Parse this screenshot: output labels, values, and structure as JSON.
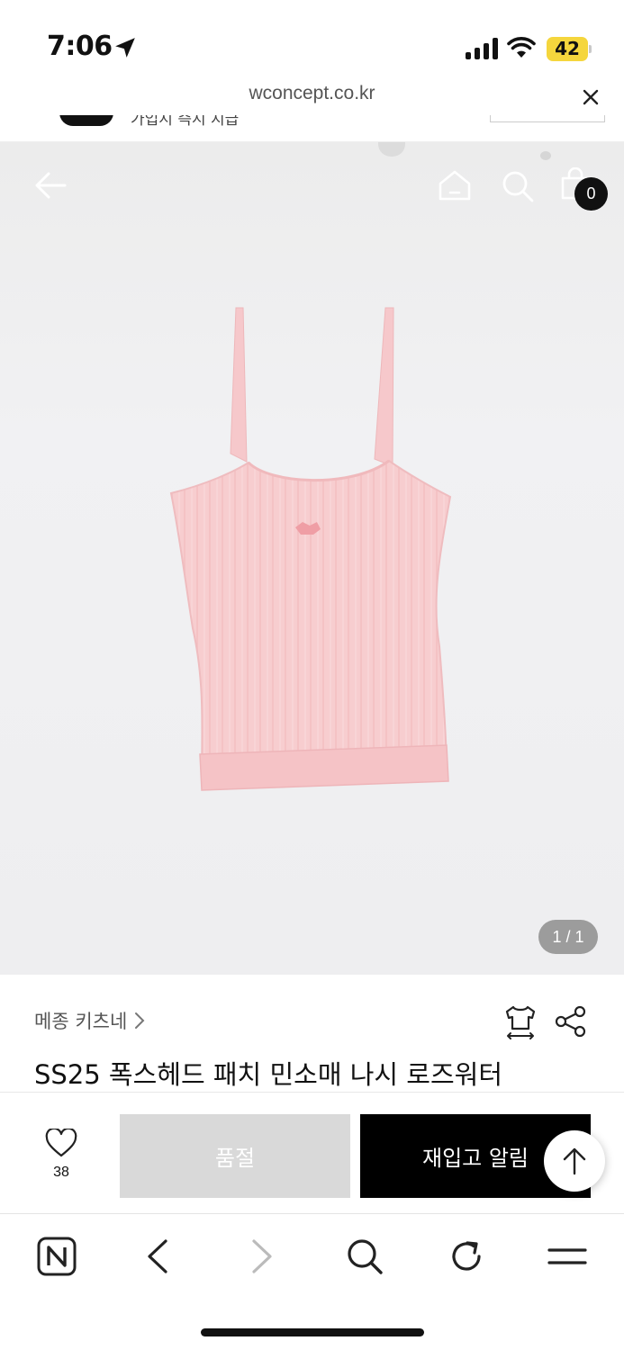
{
  "status_bar": {
    "time": "7:06",
    "battery": "42",
    "battery_color": "#f5d63d"
  },
  "browser": {
    "url": "wconcept.co.kr",
    "close_icon": "close-icon"
  },
  "banner": {
    "partial_text": "가입시 즉시 지급"
  },
  "product_image": {
    "cart_count": "0",
    "page_counter": "1 / 1",
    "garment_color": "#f7cdcf"
  },
  "product": {
    "brand": "메종 키츠네",
    "title": "SS25 폭스헤드 패치 민소매 나시 로즈워터"
  },
  "actions": {
    "wishlist_count": "38",
    "soldout_label": "품절",
    "restock_label": "재입고 알림"
  },
  "toolbar": {
    "items": [
      "naver-icon",
      "back-icon",
      "forward-icon",
      "search-icon",
      "refresh-icon",
      "menu-icon"
    ]
  }
}
